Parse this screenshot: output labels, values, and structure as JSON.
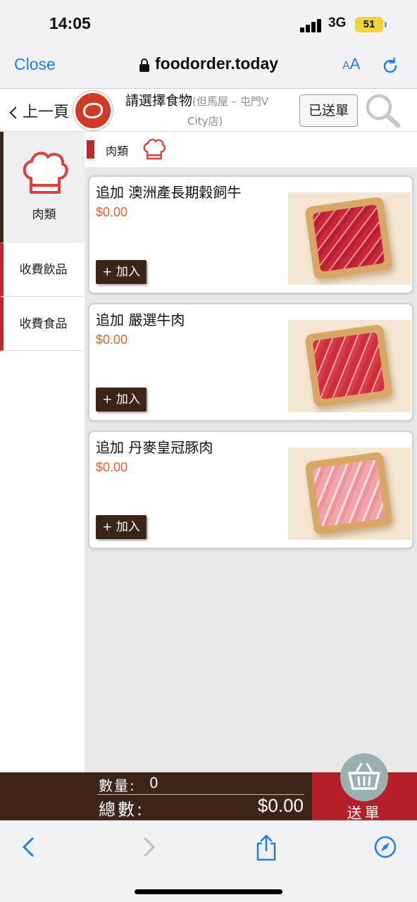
{
  "status_bar": {
    "time": "14:05",
    "network": "3G",
    "battery": "51"
  },
  "browser": {
    "close_label": "Close",
    "domain": "foodorder.today",
    "text_size_small": "A",
    "text_size_large": "A",
    "icons": [
      "lock-icon",
      "reload-icon",
      "back-arrow-icon",
      "forward-arrow-icon",
      "share-icon",
      "compass-icon"
    ]
  },
  "header": {
    "back_label": "上一頁",
    "title": "請選擇食物",
    "shop_line1": "(但馬屋 – 屯門V",
    "shop_line2": "City店)",
    "sent_label": "已送單",
    "icons": [
      "chevron-left-icon",
      "restaurant-logo",
      "search-icon"
    ]
  },
  "sidebar": {
    "active": {
      "label": "肉類",
      "icon": "chef-hat-icon"
    },
    "items": [
      {
        "label": "收費飲品"
      },
      {
        "label": "收費食品"
      }
    ]
  },
  "section": {
    "title": "肉類",
    "icon": "chef-hat-icon",
    "accent_color": "#c1272d"
  },
  "items": [
    {
      "name": "追加 澳洲產長期穀飼牛",
      "price": "$0.00",
      "add_label": "+ 加入"
    },
    {
      "name": "追加 嚴選牛肉",
      "price": "$0.00",
      "add_label": "+ 加入"
    },
    {
      "name": "追加 丹麥皇冠豚肉",
      "price": "$0.00",
      "add_label": "+ 加入"
    }
  ],
  "order_bar": {
    "qty_label": "數量:",
    "qty_value": "0",
    "total_label": "總數:",
    "total_value": "$0.00",
    "submit_label": "送單",
    "icon": "basket-icon"
  },
  "colors": {
    "brand_brown": "#3d2418",
    "brand_red": "#b51f27",
    "price_orange": "#e0622c",
    "link_blue": "#1a7ef2"
  }
}
